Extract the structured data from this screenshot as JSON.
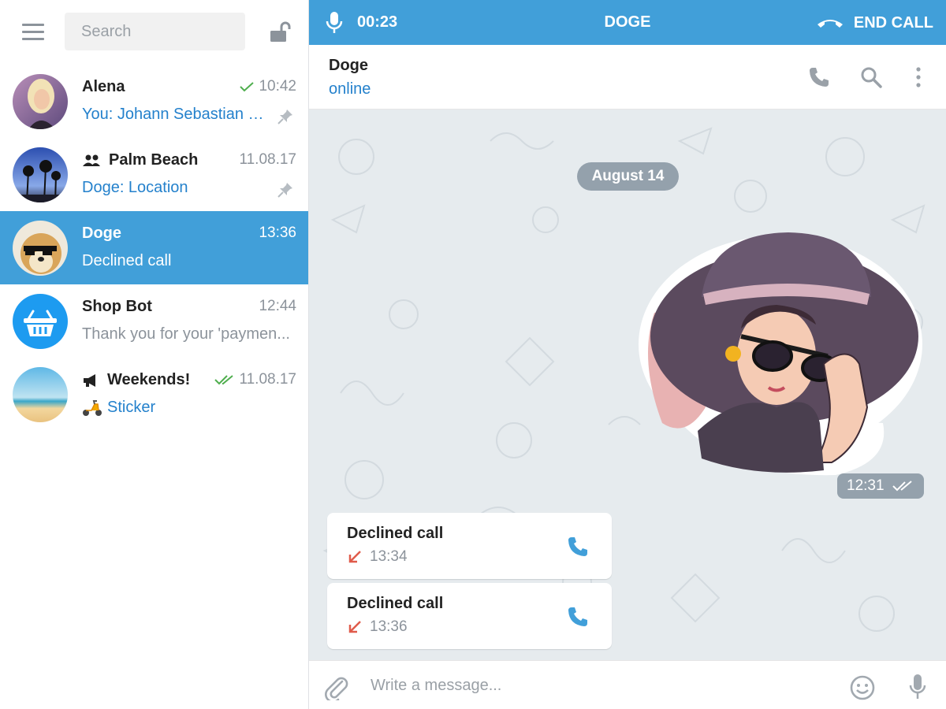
{
  "sidebar": {
    "search": {
      "placeholder": "Search"
    },
    "chats": [
      {
        "name": "Alena",
        "time": "10:42",
        "status": "read-single",
        "message": "You: Johann Sebastian B...",
        "pinned": true
      },
      {
        "name": "Palm Beach",
        "name_icon": "group-icon",
        "time": "11.08.17",
        "message": "Doge: Location",
        "pinned": true
      },
      {
        "name": "Doge",
        "time": "13:36",
        "message": "Declined call",
        "active": true
      },
      {
        "name": "Shop Bot",
        "time": "12:44",
        "message": "Thank you for your 'paymen..."
      },
      {
        "name": "Weekends!",
        "name_icon": "megaphone-icon",
        "time": "11.08.17",
        "status": "read-double",
        "message_emoji": "scooter-emoji",
        "message": "Sticker"
      }
    ]
  },
  "call_bar": {
    "timer": "00:23",
    "peer": "DOGE",
    "end_label": "END CALL"
  },
  "chat_header": {
    "name": "Doge",
    "status": "online"
  },
  "messages": {
    "date": "August 14",
    "sticker_time": "12:31",
    "calls": [
      {
        "title": "Declined call",
        "time": "13:34"
      },
      {
        "title": "Declined call",
        "time": "13:36"
      }
    ]
  },
  "composer": {
    "placeholder": "Write a message..."
  },
  "colors": {
    "accent": "#419fd9",
    "link": "#2481cc",
    "declined": "#e05b4b",
    "chat_bg": "#e6ebee",
    "read_check": "#4fae4e"
  }
}
